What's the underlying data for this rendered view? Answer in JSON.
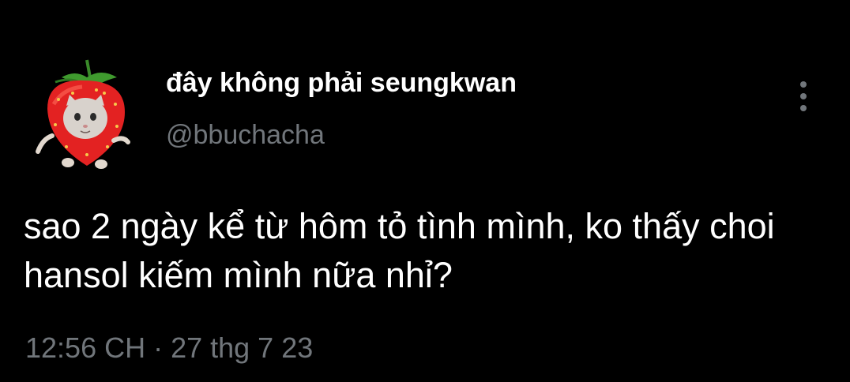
{
  "tweet": {
    "author": {
      "display_name": "đây không phải seungkwan",
      "handle": "@bbuchacha"
    },
    "text": "sao 2 ngày kể từ hôm tỏ tình mình, ko thấy choi hansol kiếm mình nữa nhỉ?",
    "timestamp": "12:56 CH · 27 thg 7 23",
    "menu_icon": "more-vertical-icon"
  },
  "colors": {
    "background": "#000000",
    "primary_text": "#ffffff",
    "secondary_text": "#71767b"
  }
}
